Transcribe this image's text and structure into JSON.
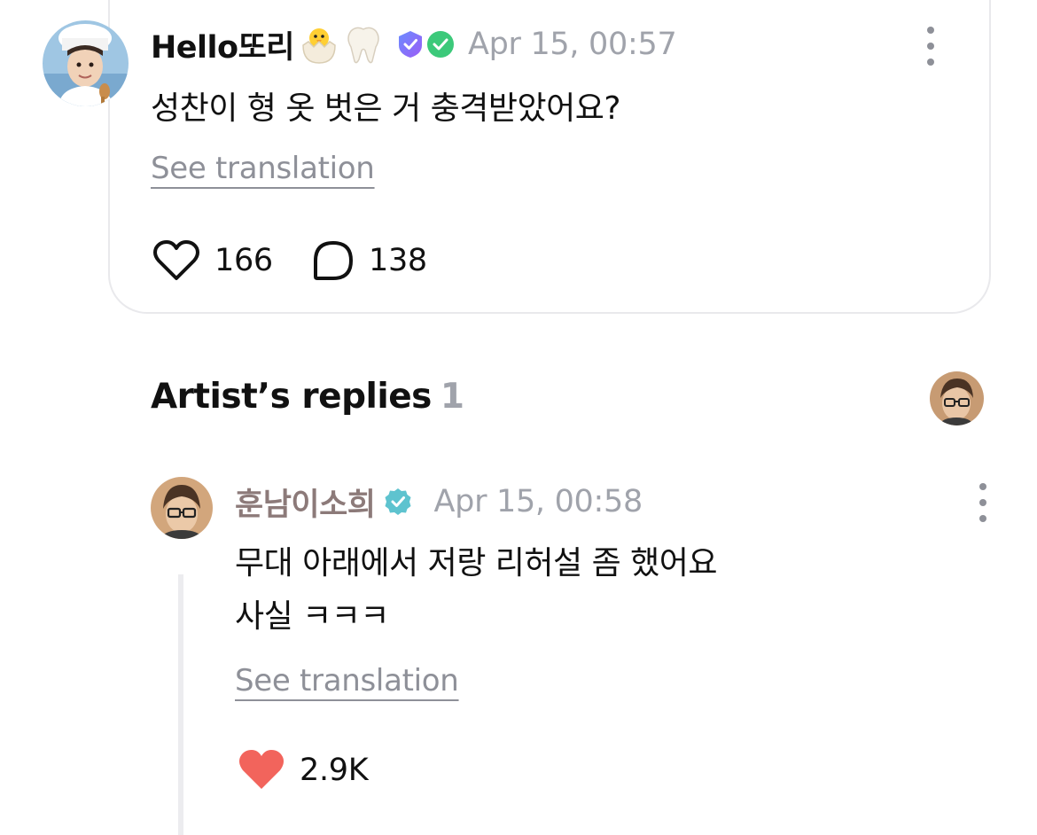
{
  "post": {
    "username": "Hello또리",
    "badges": [
      "hatching-chick-emoji",
      "tooth-emoji",
      "verified-shield-icon",
      "verified-heart-check-icon"
    ],
    "timestamp": "Apr 15, 00:57",
    "body": "성찬이 형 옷 벗은 거 충격받았어요?",
    "translate_label": "See translation",
    "likes": "166",
    "comments": "138"
  },
  "artist_replies": {
    "title": "Artist’s replies",
    "count": "1",
    "reply": {
      "username": "훈남이소희",
      "timestamp": "Apr 15, 00:58",
      "body_lines": [
        "무대 아래에서 저랑 리허설 좀 했어요",
        "사실 ㅋㅋㅋ"
      ],
      "translate_label": "See translation",
      "likes": "2.9K"
    }
  },
  "colors": {
    "heart_liked": "#f2645c",
    "verified": "#5ec3cf",
    "artist_name": "#8c7a79",
    "muted": "#a0a3ab"
  }
}
